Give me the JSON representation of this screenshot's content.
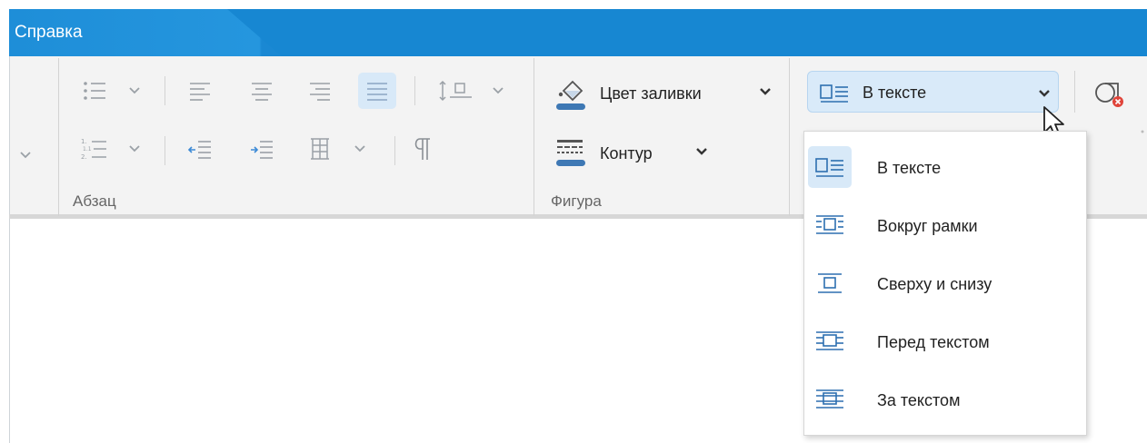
{
  "window": {
    "tab_label": "Справка"
  },
  "colors": {
    "accent": "#1a8bd6",
    "selected_bg": "#d8e9f8",
    "icon_blue": "#3c78b8"
  },
  "ribbon": {
    "paragraph_group": {
      "label": "Абзац",
      "buttons": [
        "bullet-list",
        "numbered-list",
        "align-left",
        "align-center",
        "align-right",
        "justify",
        "line-spacing",
        "decrease-indent",
        "increase-indent",
        "table-borders",
        "pilcrow"
      ]
    },
    "shape_group": {
      "label": "Фигура",
      "fill_color_label": "Цвет заливки",
      "outline_label": "Контур"
    },
    "wrap": {
      "selected_label": "В тексте"
    }
  },
  "wrap_menu": {
    "items": [
      {
        "label": "В тексте",
        "icon": "wrap-inline-icon",
        "selected": true
      },
      {
        "label": "Вокруг рамки",
        "icon": "wrap-square-icon",
        "selected": false
      },
      {
        "label": "Сверху и снизу",
        "icon": "wrap-top-bottom-icon",
        "selected": false
      },
      {
        "label": "Перед текстом",
        "icon": "wrap-in-front-icon",
        "selected": false
      },
      {
        "label": "За текстом",
        "icon": "wrap-behind-icon",
        "selected": false
      }
    ]
  }
}
